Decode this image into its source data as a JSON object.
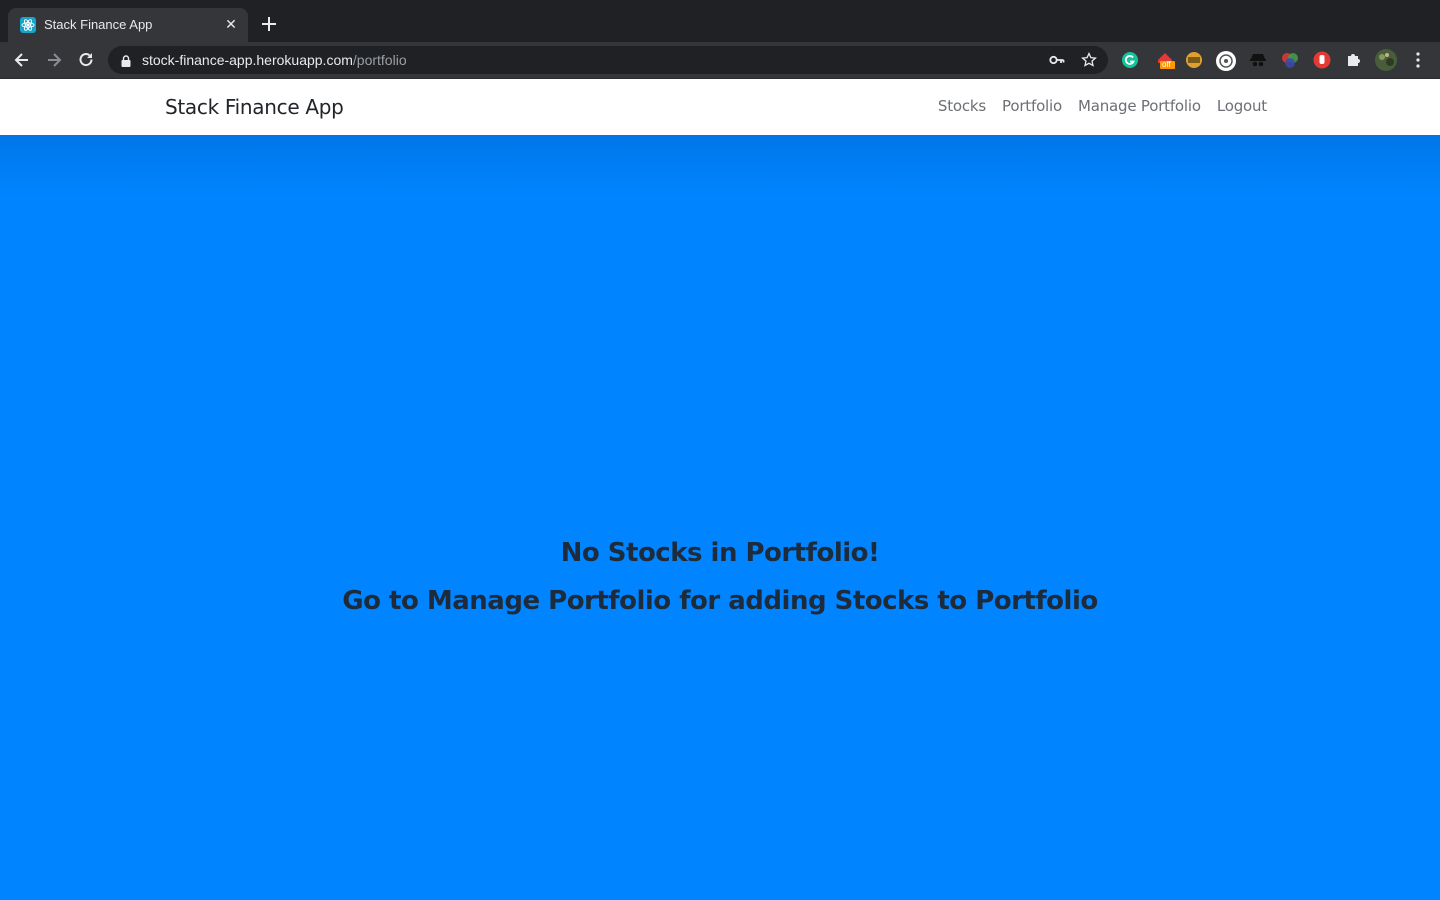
{
  "browser": {
    "tab": {
      "title": "Stack Finance App",
      "close_label": "✕"
    },
    "address": {
      "host": "stock-finance-app.herokuapp.com",
      "path": "/portfolio"
    },
    "extensions": [
      "grammarly-icon",
      "off-badge-extension-icon",
      "txt-extension-icon",
      "circle-extension-icon",
      "spy-extension-icon",
      "color-wheel-extension-icon",
      "hand-block-extension-icon",
      "puzzle-extensions-icon",
      "avatar-icon",
      "more-menu-icon"
    ],
    "extension_badge": "off"
  },
  "navbar": {
    "brand": "Stack Finance App",
    "links": [
      "Stocks",
      "Portfolio",
      "Manage Portfolio",
      "Logout"
    ]
  },
  "main": {
    "empty_title": "No Stocks in Portfolio!",
    "empty_subtitle": "Go to Manage Portfolio for adding Stocks to Portfolio"
  },
  "colors": {
    "background": "#0084ff",
    "navbar": "#ffffff",
    "heading_text": "#1d2b3a"
  }
}
